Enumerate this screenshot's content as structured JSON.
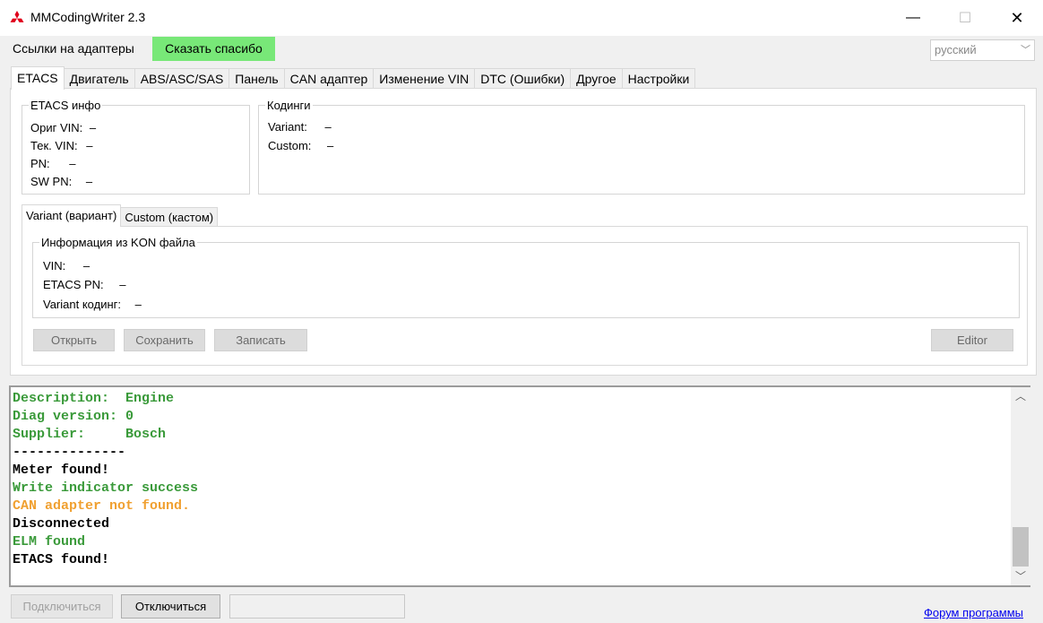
{
  "window": {
    "title": "MMCodingWriter 2.3",
    "minimize": "—",
    "maximize": "☐",
    "close": "✕"
  },
  "menu": {
    "adapter_links": "Ссылки на адаптеры",
    "thanks": "Сказать спасибо",
    "language": "русский"
  },
  "tabs": [
    "ETACS",
    "Двигатель",
    "ABS/ASC/SAS",
    "Панель",
    "CAN адаптер",
    "Изменение VIN",
    "DTC (Ошибки)",
    "Другое",
    "Настройки"
  ],
  "etacs_info": {
    "legend": "ETACS инфо",
    "orig_vin_label": "Ориг VIN:",
    "orig_vin_value": "–",
    "cur_vin_label": "Тек. VIN:",
    "cur_vin_value": "–",
    "pn_label": "PN:",
    "pn_value": "–",
    "swpn_label": "SW PN:",
    "swpn_value": "–"
  },
  "codings": {
    "legend": "Кодинги",
    "variant_label": "Variant:",
    "variant_value": "–",
    "custom_label": "Custom:",
    "custom_value": "–"
  },
  "sub_tabs": [
    "Variant (вариант)",
    "Custom (кастом)"
  ],
  "kon_info": {
    "legend": "Информация из KON файла",
    "vin_label": "VIN:",
    "vin_value": "–",
    "etacs_pn_label": "ETACS PN:",
    "etacs_pn_value": "–",
    "variant_coding_label": "Variant кодинг:",
    "variant_coding_value": "–"
  },
  "actions": {
    "open": "Открыть",
    "save": "Сохранить",
    "write": "Записать",
    "editor": "Editor"
  },
  "log": [
    {
      "text": "Description:  Engine",
      "color": "#3a9a3a"
    },
    {
      "text": "Diag version: 0",
      "color": "#3a9a3a"
    },
    {
      "text": "Supplier:     Bosch",
      "color": "#3a9a3a"
    },
    {
      "text": "--------------",
      "color": "#000000"
    },
    {
      "text": "Meter found!",
      "color": "#000000"
    },
    {
      "text": "Write indicator success",
      "color": "#3a9a3a"
    },
    {
      "text": "CAN adapter not found.",
      "color": "#f0a030"
    },
    {
      "text": "Disconnected",
      "color": "#000000"
    },
    {
      "text": "ELM found",
      "color": "#3a9a3a"
    },
    {
      "text": "ETACS found!",
      "color": "#000000"
    }
  ],
  "bottom": {
    "connect": "Подключиться",
    "disconnect": "Отключиться",
    "status": "",
    "forum": "Форум программы"
  },
  "colors": {
    "thanks_bg": "#78e878",
    "log_green": "#3a9a3a",
    "log_orange": "#f0a030",
    "link": "#0000ee",
    "brand_red": "#e0001a"
  }
}
